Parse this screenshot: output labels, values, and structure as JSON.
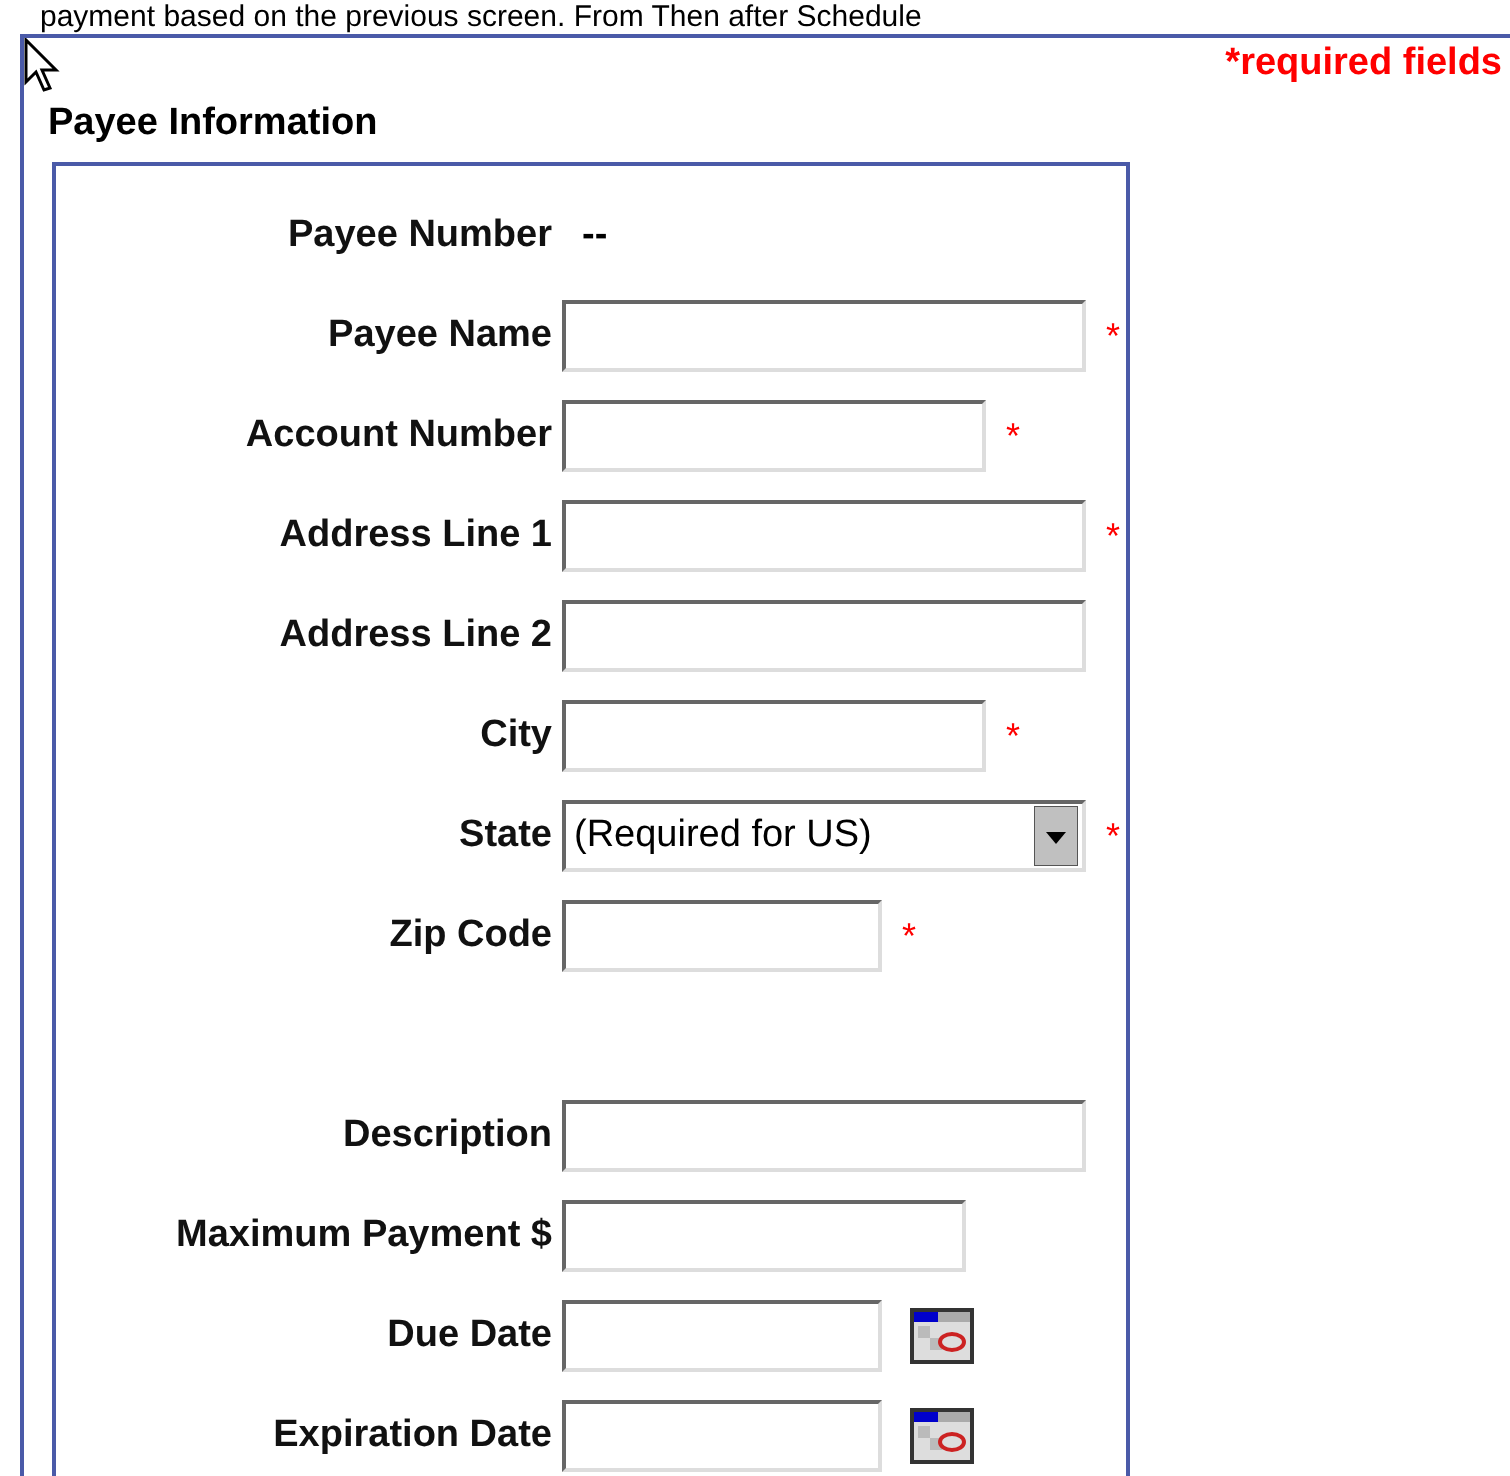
{
  "intro_text": "payment based on the previous screen. From Then after Schedule",
  "required_note": "*required fields",
  "section": {
    "title": "Payee Information",
    "groups": [
      [
        {
          "kind": "static",
          "label": "Payee Number",
          "value": "--"
        },
        {
          "kind": "text",
          "label": "Payee Name",
          "required_mark": "*"
        },
        {
          "kind": "text",
          "label": "Account Number",
          "required_mark": "*"
        },
        {
          "kind": "text",
          "label": "Address Line 1",
          "required_mark": "*"
        },
        {
          "kind": "text",
          "label": "Address Line 2"
        },
        {
          "kind": "text",
          "label": "City",
          "required_mark": "*"
        },
        {
          "kind": "select",
          "label": "State",
          "value": "(Required for US)",
          "required_mark": "*"
        },
        {
          "kind": "text",
          "label": "Zip Code",
          "required_mark": "*"
        }
      ],
      [
        {
          "kind": "text",
          "label": "Description"
        },
        {
          "kind": "text",
          "label": "Maximum Payment $"
        },
        {
          "kind": "date",
          "label": "Due Date"
        },
        {
          "kind": "date",
          "label": "Expiration Date"
        }
      ]
    ]
  }
}
